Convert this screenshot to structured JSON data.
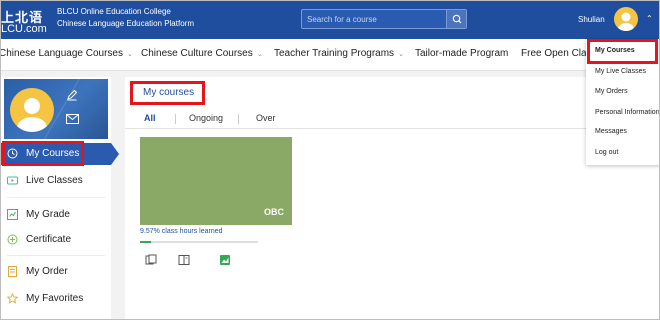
{
  "header": {
    "logo_cn": "上北语",
    "logo_en": "LCU.com",
    "college_line1": "BLCU Online Education College",
    "college_line2": "Chinese Language Education Platform",
    "search_placeholder": "Search for a course",
    "user_name": "Shulian"
  },
  "nav": {
    "items": [
      {
        "label": "Chinese Language Courses",
        "has_caret": true
      },
      {
        "label": "Chinese Culture Courses",
        "has_caret": true
      },
      {
        "label": "Teacher Training Programs",
        "has_caret": true
      },
      {
        "label": "Tailor-made Program",
        "has_caret": false
      },
      {
        "label": "Free Open Clas",
        "has_caret": false
      }
    ]
  },
  "sidebar": {
    "items": [
      {
        "label": "My Courses",
        "icon": "clock-icon",
        "active": true
      },
      {
        "label": "Live Classes",
        "icon": "live-icon"
      },
      {
        "label": "My Grade",
        "icon": "grade-icon"
      },
      {
        "label": "Certificate",
        "icon": "certificate-icon"
      },
      {
        "label": "My Order",
        "icon": "order-icon"
      },
      {
        "label": "My Favorites",
        "icon": "star-icon"
      }
    ]
  },
  "main": {
    "title": "My courses",
    "tabs": [
      {
        "label": "All",
        "active": true
      },
      {
        "label": "Ongoing"
      },
      {
        "label": "Over"
      }
    ],
    "course": {
      "code": "OBC",
      "progress_text": "9.57% class hours learned",
      "progress": 0.0957,
      "icons": [
        "notes-icon",
        "book-icon",
        "stats-icon"
      ]
    }
  },
  "dropdown": {
    "items": [
      {
        "label": "My Courses",
        "active": true
      },
      {
        "label": "My Live Classes"
      },
      {
        "label": "My Orders"
      },
      {
        "label": "Personal Information"
      },
      {
        "label": "Messages"
      },
      {
        "label": "Log out"
      }
    ]
  },
  "colors": {
    "brand_blue": "#1f4e9e",
    "highlight_red": "#e5151e",
    "course_green": "#8aa866",
    "progress_green": "#35a853",
    "avatar_yellow": "#f6c443"
  }
}
